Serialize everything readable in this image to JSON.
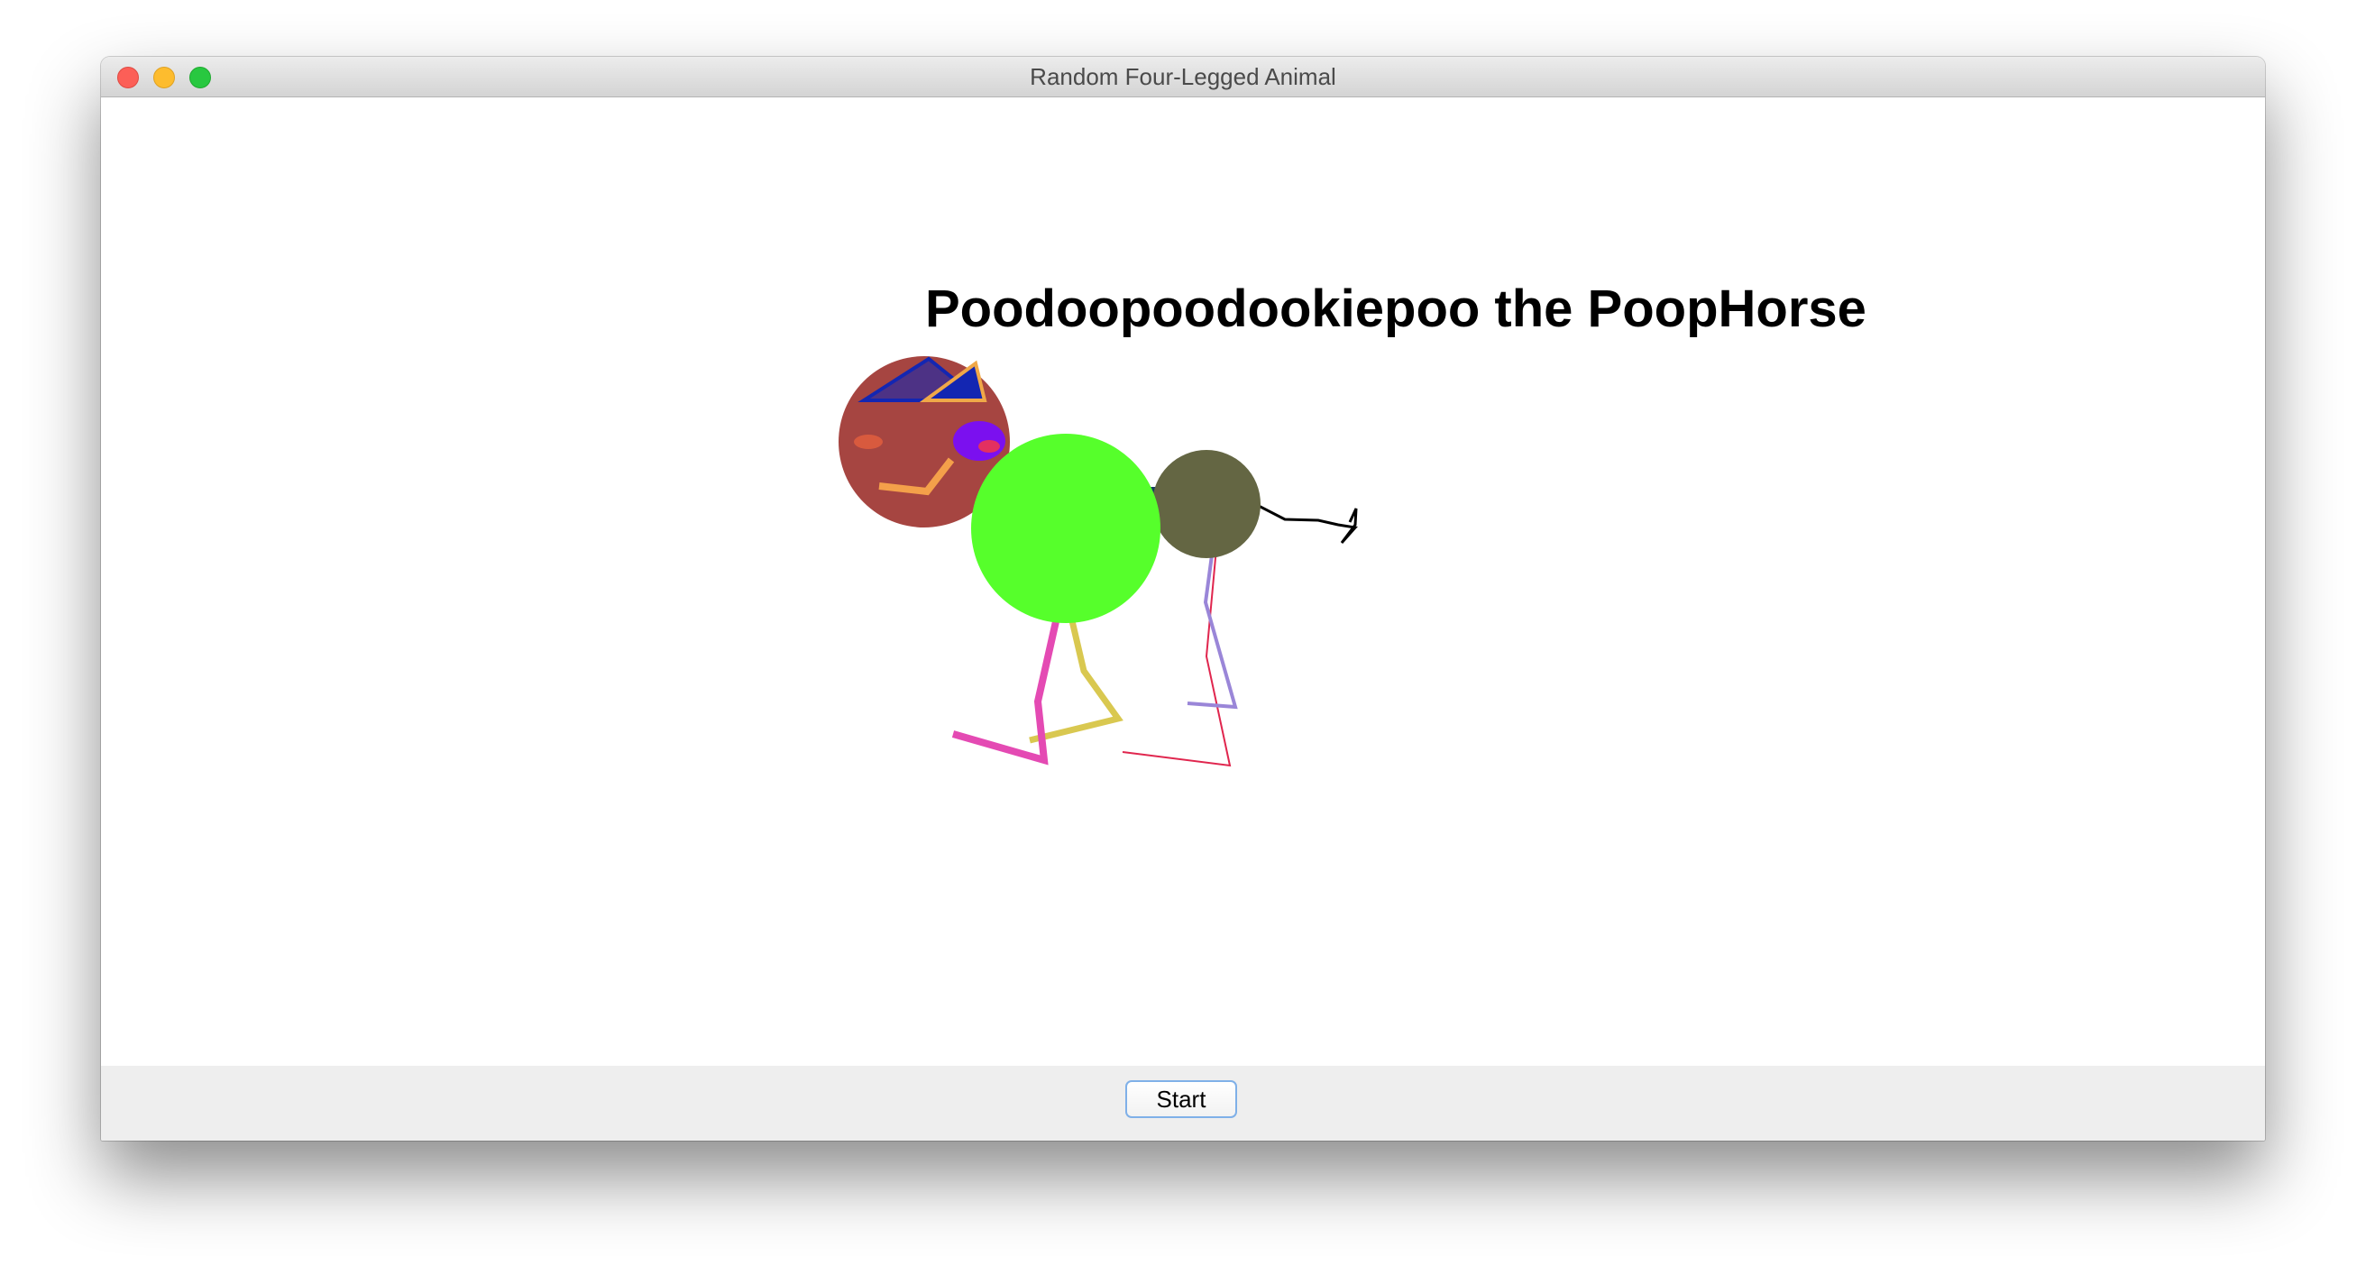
{
  "window": {
    "title": "Random Four-Legged Animal"
  },
  "canvas": {
    "animal_name": "Poodoopoodookiepoo the PoopHorse"
  },
  "bottom_panel": {
    "start_label": "Start"
  },
  "colors": {
    "head": "#a64541",
    "body": "#56ff2b",
    "hip": "#646643",
    "connector": "#163d62",
    "ear_blue": "#1326b2",
    "ear_outline": "#f0a848",
    "eye": "#7b10ef",
    "mouth": "#f4a04a",
    "front_leg_pink": "#e44ab3",
    "front_leg_yellow": "#d9c850",
    "back_leg_red": "#e0264e",
    "back_leg_purple": "#9a86d8"
  }
}
